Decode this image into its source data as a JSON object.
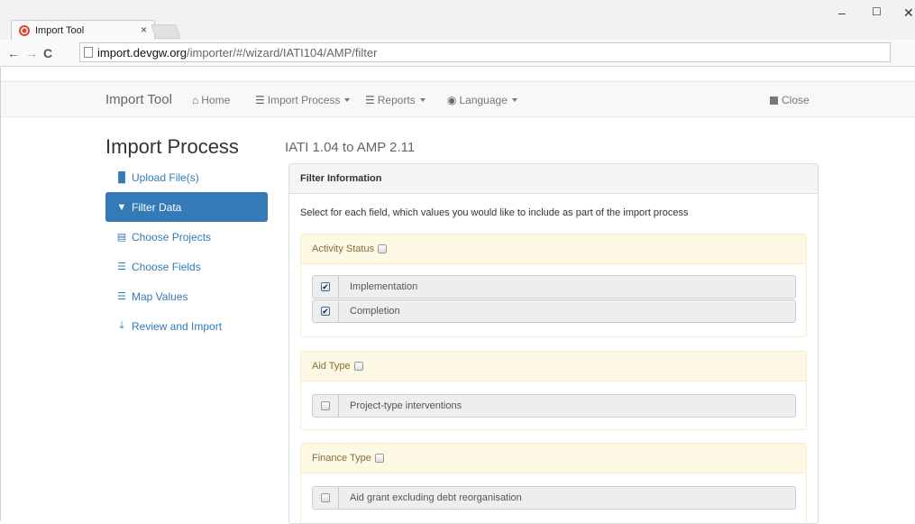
{
  "browser": {
    "tab_title": "Import Tool",
    "tab_close": "×",
    "url_host": "import.devgw.org",
    "url_path": "/importer/#/wizard/IATI104/AMP/filter",
    "window": {
      "minimize": "–",
      "maximize": "☐",
      "close": "✕"
    },
    "nav": {
      "back": "←",
      "forward": "→",
      "reload": "C"
    }
  },
  "navbar": {
    "brand": "Import Tool",
    "home": "Home",
    "import_process": "Import Process",
    "reports": "Reports",
    "language": "Language",
    "close": "Close"
  },
  "page_title": "Import Process",
  "subtitle": "IATI 1.04 to AMP 2.11",
  "sidebar": {
    "items": [
      {
        "label": "Upload File(s)",
        "icon": "file-icon"
      },
      {
        "label": "Filter Data",
        "icon": "filter-icon",
        "active": true
      },
      {
        "label": "Choose Projects",
        "icon": "list-icon"
      },
      {
        "label": "Choose Fields",
        "icon": "list-icon"
      },
      {
        "label": "Map Values",
        "icon": "list-icon"
      },
      {
        "label": "Review and Import",
        "icon": "download-icon"
      }
    ]
  },
  "panel": {
    "heading": "Filter Information",
    "intro": "Select for each field, which values you would like to include as part of the import process",
    "groups": [
      {
        "title": "Activity Status",
        "rows": [
          {
            "label": "Implementation",
            "checked": true
          },
          {
            "label": "Completion",
            "checked": true
          }
        ]
      },
      {
        "title": "Aid Type",
        "rows": [
          {
            "label": "Project-type interventions",
            "checked": false
          }
        ]
      },
      {
        "title": "Finance Type",
        "rows": [
          {
            "label": "Aid grant excluding debt reorganisation",
            "checked": false
          }
        ]
      }
    ]
  },
  "colors": {
    "primary": "#337ab7",
    "warning_bg": "#fcf8e3",
    "warning_border": "#faebcc"
  }
}
